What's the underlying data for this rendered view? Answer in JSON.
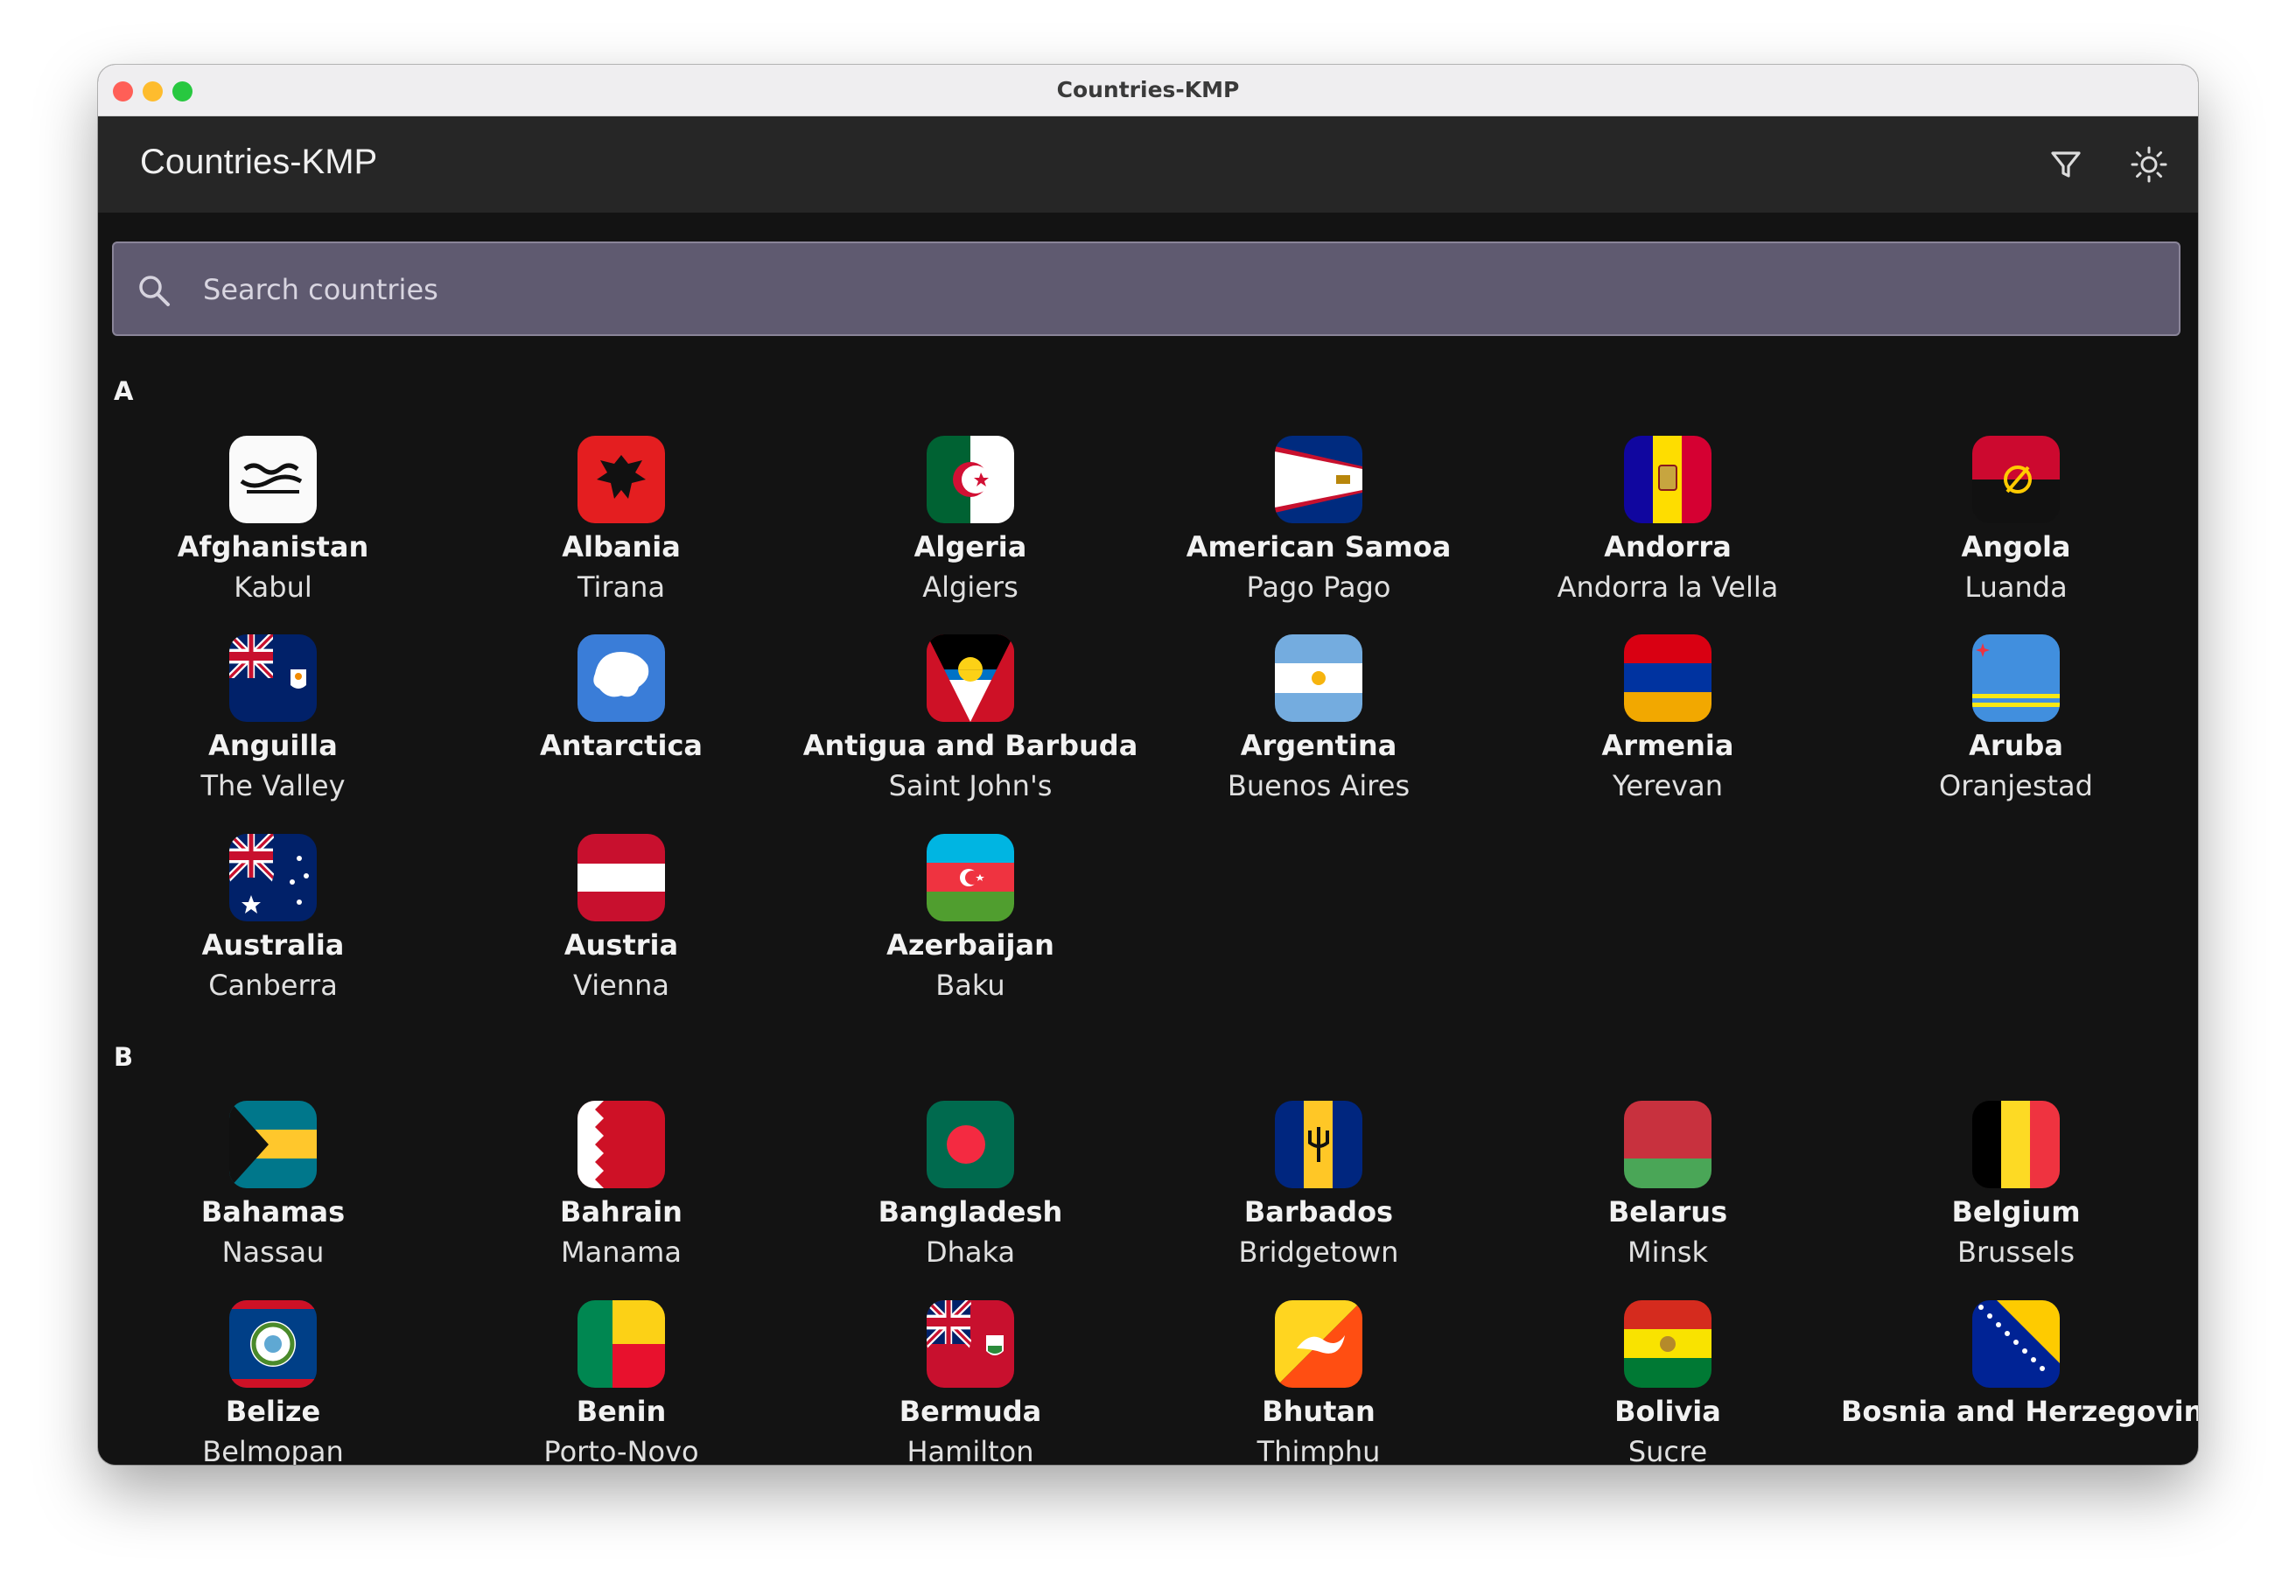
{
  "window": {
    "title": "Countries-KMP"
  },
  "appbar": {
    "title": "Countries-KMP",
    "filter_icon": "filter-icon",
    "theme_icon": "sun-icon"
  },
  "search": {
    "placeholder": "Search countries",
    "value": "",
    "icon": "search-icon"
  },
  "sections": [
    {
      "letter": "A",
      "countries": [
        {
          "name": "Afghanistan",
          "capital": "Kabul"
        },
        {
          "name": "Albania",
          "capital": "Tirana"
        },
        {
          "name": "Algeria",
          "capital": "Algiers"
        },
        {
          "name": "American Samoa",
          "capital": "Pago Pago"
        },
        {
          "name": "Andorra",
          "capital": "Andorra la Vella"
        },
        {
          "name": "Angola",
          "capital": "Luanda"
        },
        {
          "name": "Anguilla",
          "capital": "The Valley"
        },
        {
          "name": "Antarctica",
          "capital": ""
        },
        {
          "name": "Antigua and Barbuda",
          "capital": "Saint John's"
        },
        {
          "name": "Argentina",
          "capital": "Buenos Aires"
        },
        {
          "name": "Armenia",
          "capital": "Yerevan"
        },
        {
          "name": "Aruba",
          "capital": "Oranjestad"
        },
        {
          "name": "Australia",
          "capital": "Canberra"
        },
        {
          "name": "Austria",
          "capital": "Vienna"
        },
        {
          "name": "Azerbaijan",
          "capital": "Baku"
        }
      ]
    },
    {
      "letter": "B",
      "countries": [
        {
          "name": "Bahamas",
          "capital": "Nassau"
        },
        {
          "name": "Bahrain",
          "capital": "Manama"
        },
        {
          "name": "Bangladesh",
          "capital": "Dhaka"
        },
        {
          "name": "Barbados",
          "capital": "Bridgetown"
        },
        {
          "name": "Belarus",
          "capital": "Minsk"
        },
        {
          "name": "Belgium",
          "capital": "Brussels"
        },
        {
          "name": "Belize",
          "capital": "Belmopan"
        },
        {
          "name": "Benin",
          "capital": "Porto-Novo"
        },
        {
          "name": "Bermuda",
          "capital": "Hamilton"
        },
        {
          "name": "Bhutan",
          "capital": "Thimphu"
        },
        {
          "name": "Bolivia",
          "capital": "Sucre"
        },
        {
          "name": "Bosnia and Herzegovina",
          "capital": ""
        }
      ]
    }
  ]
}
